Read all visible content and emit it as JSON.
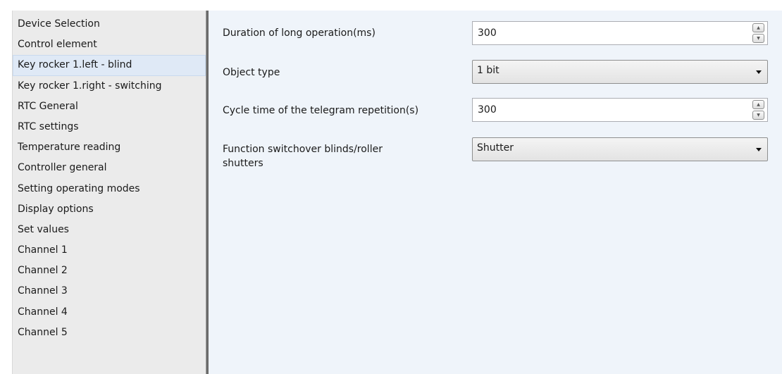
{
  "sidebar": {
    "items": [
      {
        "label": "Device Selection"
      },
      {
        "label": "Control element"
      },
      {
        "label": "Key rocker 1.left - blind",
        "selected": true
      },
      {
        "label": "Key rocker 1.right - switching"
      },
      {
        "label": "RTC General"
      },
      {
        "label": "RTC settings"
      },
      {
        "label": "Temperature reading"
      },
      {
        "label": "Controller general"
      },
      {
        "label": "Setting operating modes"
      },
      {
        "label": "Display options"
      },
      {
        "label": "Set values"
      },
      {
        "label": "Channel 1"
      },
      {
        "label": "Channel 2"
      },
      {
        "label": "Channel 3"
      },
      {
        "label": "Channel 4"
      },
      {
        "label": "Channel 5"
      }
    ]
  },
  "params": {
    "long_operation": {
      "label": "Duration of long operation(ms)",
      "value": "300",
      "control": "spinbox"
    },
    "object_type": {
      "label": "Object type",
      "value": "1 bit",
      "control": "dropdown"
    },
    "cycle_time": {
      "label": "Cycle time of the telegram repetition(s)",
      "value": "300",
      "control": "spinbox"
    },
    "function_switchover": {
      "label_line1": "Function switchover blinds/roller",
      "label_line2": "shutters",
      "value": "Shutter",
      "control": "dropdown"
    }
  },
  "icons": {
    "spin_up": "spin-up-icon",
    "spin_down": "spin-down-icon",
    "dropdown_arrow": "chevron-down-icon"
  },
  "colors": {
    "sidebar_bg": "#ebebeb",
    "content_bg": "#eff4fa",
    "selected_item_bg": "#dfe9f6",
    "splitter": "#6b6b6b"
  }
}
